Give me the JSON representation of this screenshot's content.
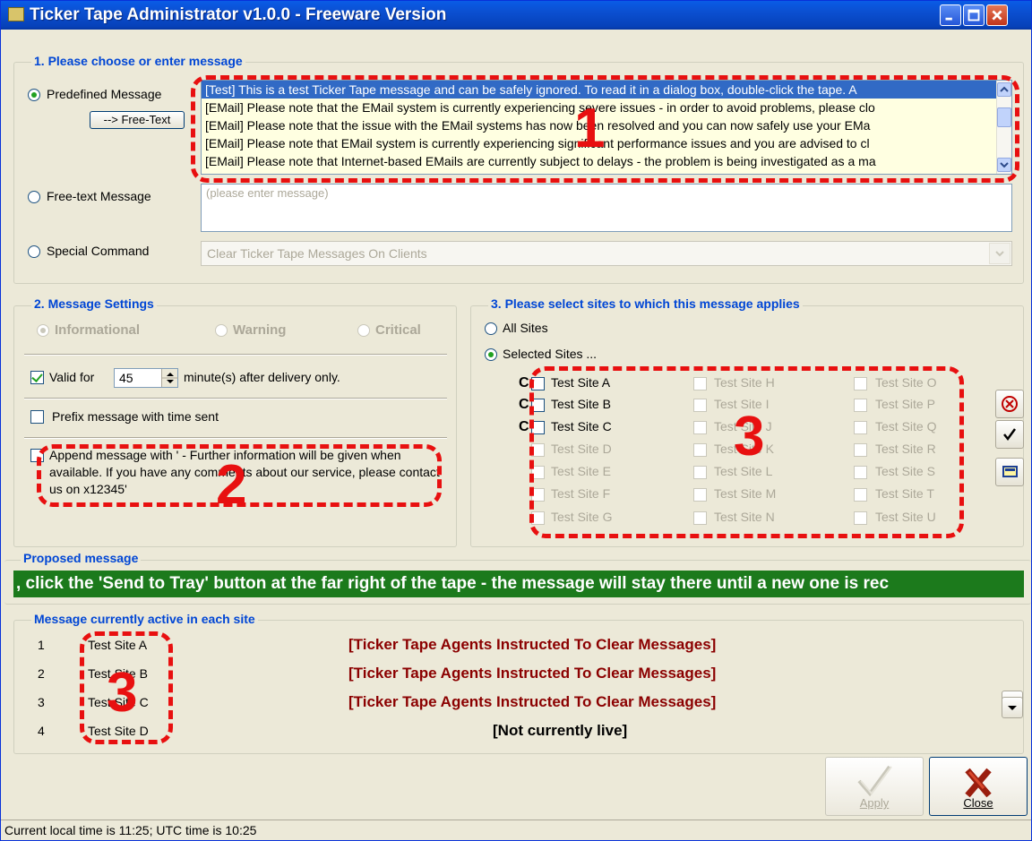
{
  "window": {
    "title": "Ticker Tape Administrator v1.0.0 - Freeware Version"
  },
  "section1": {
    "title": "1. Please choose or enter message",
    "predefined_label": "Predefined Message",
    "free_text_button": "--> Free-Text",
    "free_text_label": "Free-text Message",
    "free_text_placeholder": "(please enter message)",
    "special_label": "Special Command",
    "special_value": "Clear Ticker Tape Messages On Clients",
    "messages": [
      "[Test] This is a test Ticker Tape message and can be safely ignored. To read it in a dialog box, double-click the tape. A",
      "[EMail] Please note that the EMail system is currently experiencing severe issues - in order to avoid problems, please clo",
      "[EMail] Please note that the issue with the EMail systems has now been resolved and you can now safely use your EMa",
      "[EMail] Please note that EMail system is currently experiencing significant performance issues and you are advised to cl",
      "[EMail] Please note that Internet-based EMails are currently subject to delays - the problem is being investigated as a ma"
    ]
  },
  "section2": {
    "title": "2. Message Settings",
    "severity": [
      "Informational",
      "Warning",
      "Critical"
    ],
    "valid_for_label": "Valid for",
    "valid_for_value": "45",
    "valid_for_suffix": "minute(s) after delivery only.",
    "prefix_label": "Prefix message with time sent",
    "append_label": "Append message with ' - Further information will be given when available. If you have any comments about our service, please contact us on x12345'"
  },
  "section3": {
    "title": "3. Please select sites to which this message applies",
    "all_sites": "All Sites",
    "selected_sites": "Selected Sites ...",
    "column1": [
      "Test Site A",
      "Test Site B",
      "Test Site C",
      "Test Site D",
      "Test Site E",
      "Test Site F",
      "Test Site G"
    ],
    "column2": [
      "Test Site H",
      "Test Site I",
      "Test Site J",
      "Test Site K",
      "Test Site L",
      "Test Site M",
      "Test Site N"
    ],
    "column3": [
      "Test Site O",
      "Test Site P",
      "Test Site Q",
      "Test Site R",
      "Test Site S",
      "Test Site T",
      "Test Site U"
    ],
    "conn_marker": "C"
  },
  "proposed": {
    "title": "Proposed message",
    "text": ", click the 'Send to Tray' button at the far right of the tape - the message will stay there until a new one is rec"
  },
  "active": {
    "title": "Message currently active in each site",
    "rows": [
      {
        "num": "1",
        "site": "Test Site A",
        "message": "[Ticker Tape Agents Instructed To Clear Messages]"
      },
      {
        "num": "2",
        "site": "Test Site B",
        "message": "[Ticker Tape Agents Instructed To Clear Messages]"
      },
      {
        "num": "3",
        "site": "Test Site C",
        "message": "[Ticker Tape Agents Instructed To Clear Messages]"
      },
      {
        "num": "4",
        "site": "Test Site D",
        "message": "[Not currently live]"
      }
    ]
  },
  "buttons": {
    "apply": "Apply",
    "close": "Close"
  },
  "status": {
    "text": "Current local time is 11:25;  UTC time is 10:25"
  },
  "annotations": [
    "1",
    "2",
    "3",
    "3"
  ],
  "colors": {
    "group_title": "#0046d5",
    "ticker_bg": "#1c7a1c",
    "active_msg": "#8b0000",
    "annotation": "#e81010",
    "selection": "#316ac5"
  },
  "icons": [
    "app-icon",
    "minimize-icon",
    "maximize-icon",
    "close-icon",
    "deselect-all-icon",
    "select-all-icon",
    "copy-sites-icon",
    "scroll-up-icon",
    "scroll-down-icon",
    "apply-checkmark-icon",
    "close-x-icon"
  ]
}
